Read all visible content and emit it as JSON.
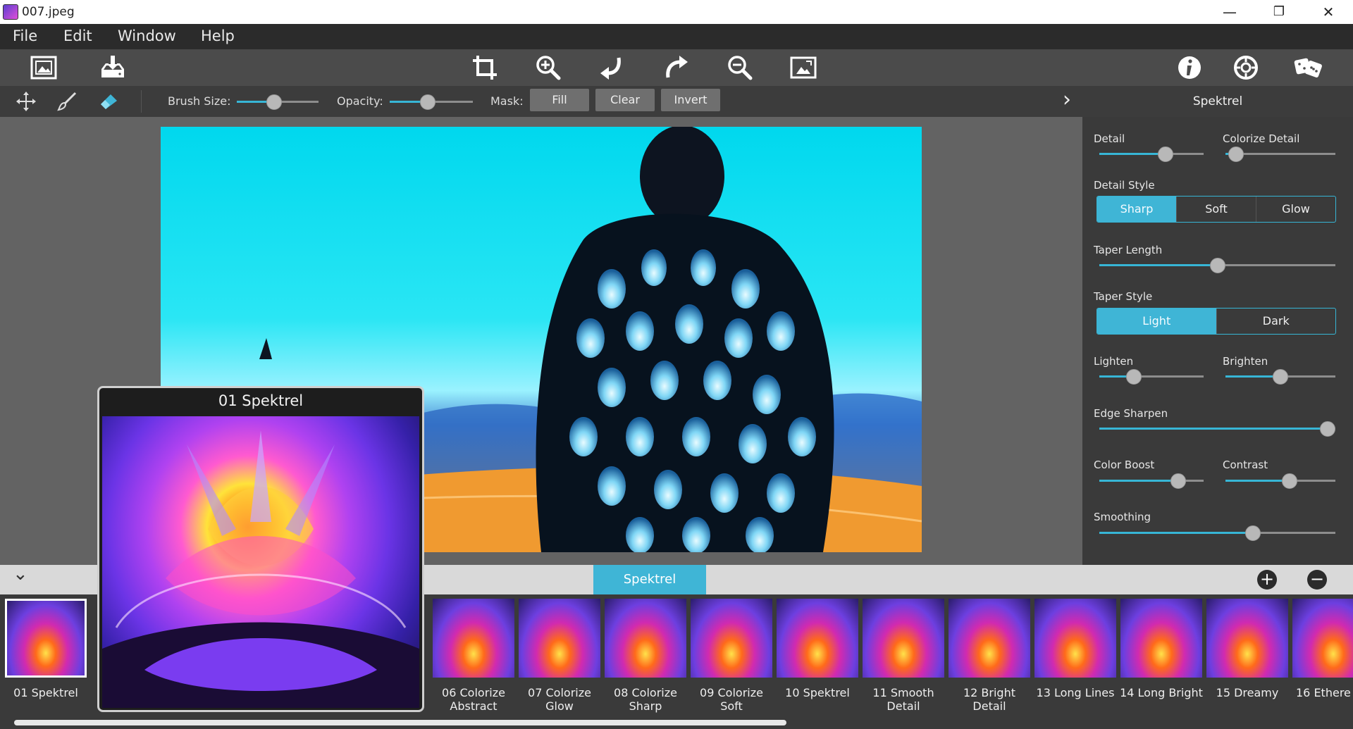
{
  "window": {
    "title": "007.jpeg",
    "minimize": "—",
    "maximize": "❐",
    "close": "✕"
  },
  "menu": [
    "File",
    "Edit",
    "Window",
    "Help"
  ],
  "options": {
    "brush_size_label": "Brush Size:",
    "brush_size_value": 0.45,
    "opacity_label": "Opacity:",
    "opacity_value": 0.45,
    "mask_label": "Mask:",
    "mask_buttons": [
      "Fill",
      "Clear",
      "Invert"
    ],
    "expand_chevron": "›"
  },
  "panel": {
    "title": "Spektrel",
    "detail": {
      "label": "Detail",
      "value": 0.66
    },
    "colorize_detail": {
      "label": "Colorize Detail",
      "value": 0.03
    },
    "detail_style": {
      "label": "Detail Style",
      "options": [
        "Sharp",
        "Soft",
        "Glow"
      ],
      "selected": "Sharp"
    },
    "taper_length": {
      "label": "Taper Length",
      "value": 0.5
    },
    "taper_style": {
      "label": "Taper Style",
      "options": [
        "Light",
        "Dark"
      ],
      "selected": "Light"
    },
    "lighten": {
      "label": "Lighten",
      "value": 0.3
    },
    "brighten": {
      "label": "Brighten",
      "value": 0.5
    },
    "edge_sharpen": {
      "label": "Edge Sharpen",
      "value": 1.0
    },
    "color_boost": {
      "label": "Color Boost",
      "value": 0.8
    },
    "contrast": {
      "label": "Contrast",
      "value": 0.6
    },
    "smoothing": {
      "label": "Smoothing",
      "value": 0.66
    }
  },
  "strip": {
    "active_tab": "Spektrel",
    "add": "+",
    "remove": "−",
    "collapse": "⌄",
    "presets": [
      {
        "label": "01 Spektrel",
        "selected": true
      },
      {
        "label": "06 Colorize Abstract"
      },
      {
        "label": "07 Colorize Glow"
      },
      {
        "label": "08 Colorize Sharp"
      },
      {
        "label": "09 Colorize Soft"
      },
      {
        "label": "10 Spektrel"
      },
      {
        "label": "11 Smooth Detail"
      },
      {
        "label": "12 Bright Detail"
      },
      {
        "label": "13 Long Lines"
      },
      {
        "label": "14 Long Bright"
      },
      {
        "label": "15 Dreamy"
      },
      {
        "label": "16 Ethere"
      }
    ]
  },
  "preview": {
    "title": "01 Spektrel"
  },
  "colors": {
    "accent": "#3fb5d6",
    "panel": "#3a3a3a",
    "menubar": "#2b2b2b"
  }
}
